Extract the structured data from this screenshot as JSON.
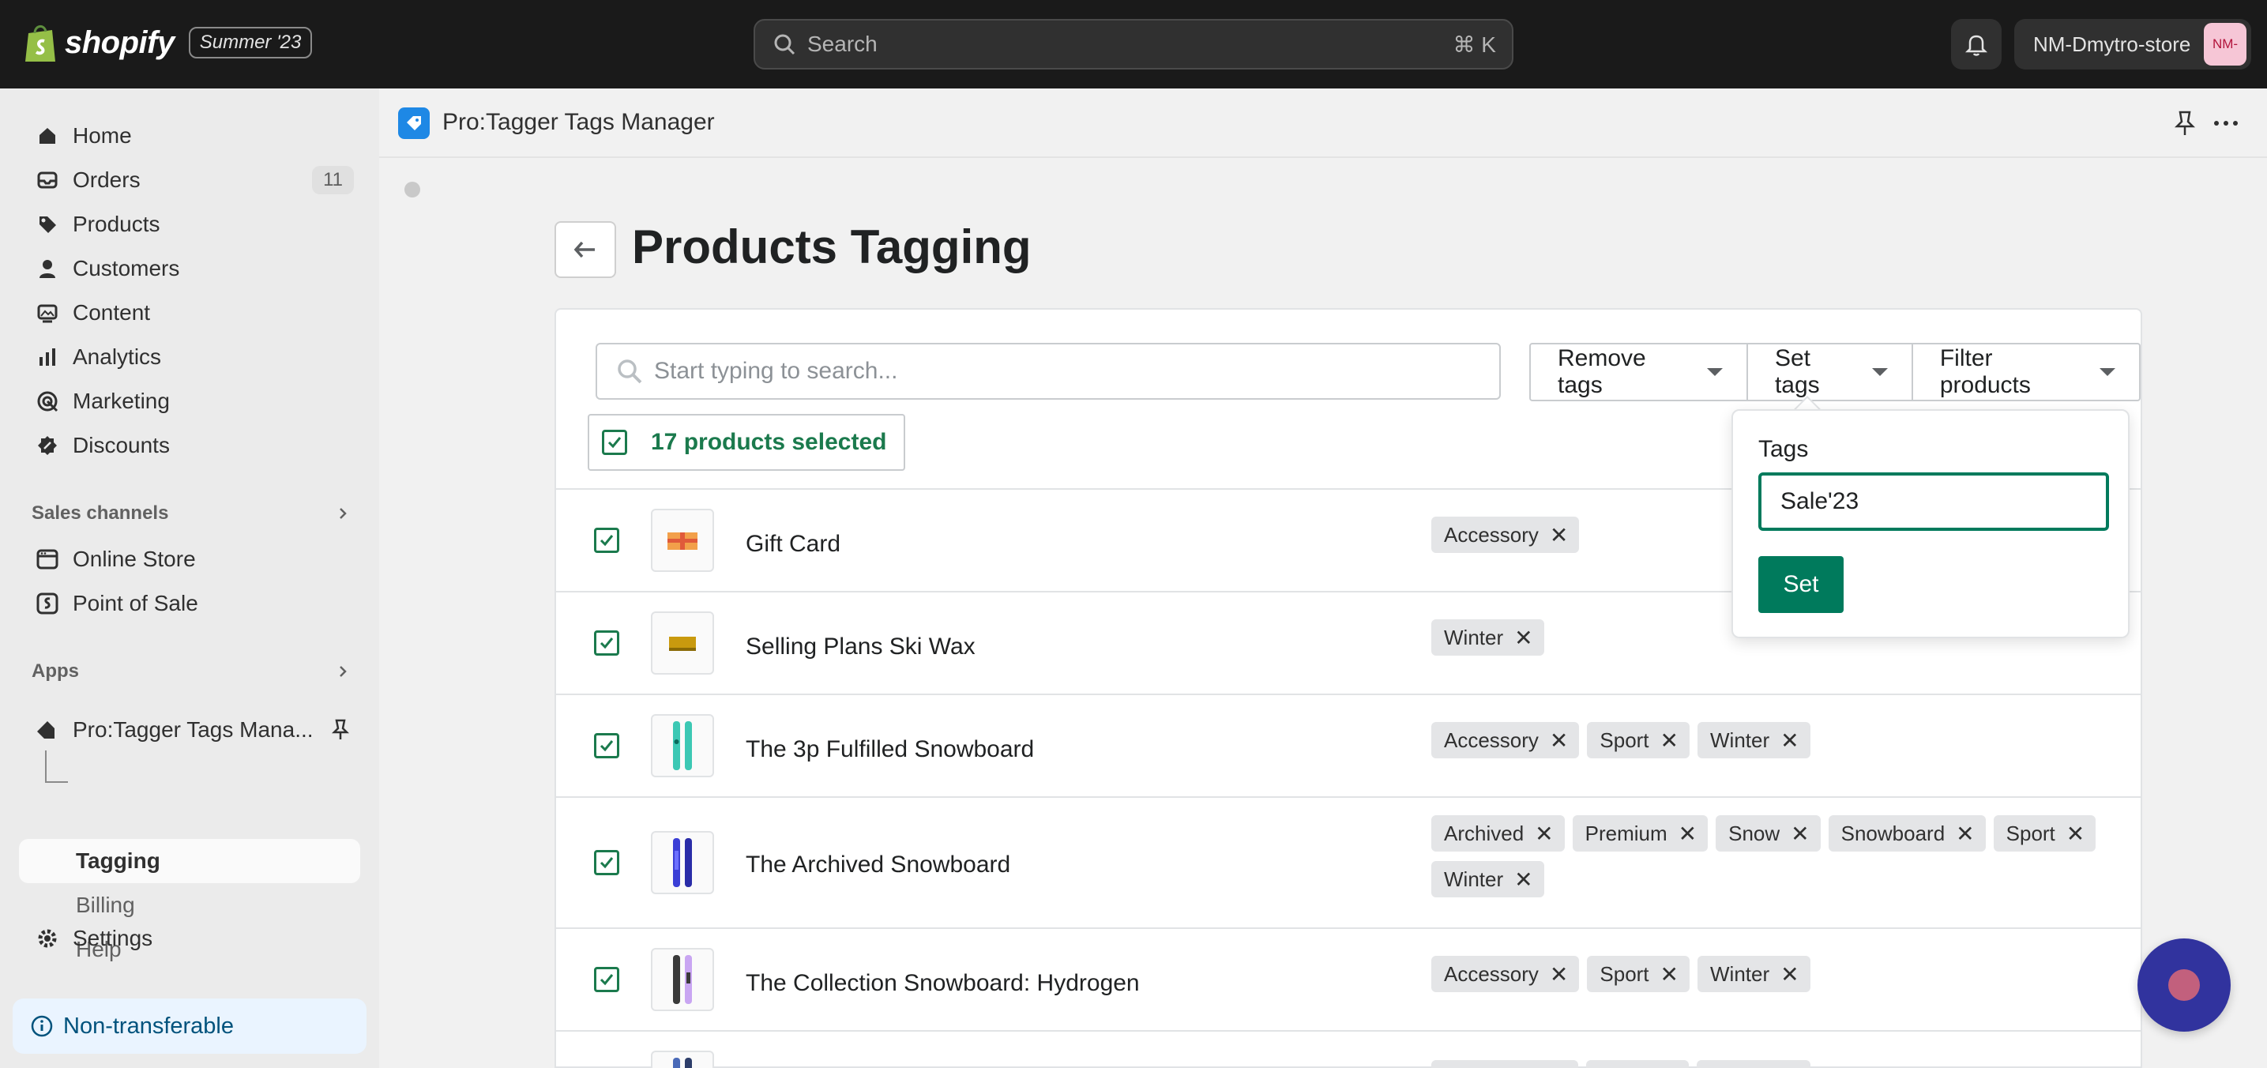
{
  "topbar": {
    "brand": "shopify",
    "edition": "Summer '23",
    "search_placeholder": "Search",
    "search_shortcut": "⌘ K",
    "store_name": "NM-Dmytro-store",
    "store_avatar": "NM-"
  },
  "sidebar": {
    "items": [
      {
        "label": "Home",
        "icon": "home-icon"
      },
      {
        "label": "Orders",
        "icon": "inbox-icon",
        "badge": "11"
      },
      {
        "label": "Products",
        "icon": "tag-icon"
      },
      {
        "label": "Customers",
        "icon": "person-icon"
      },
      {
        "label": "Content",
        "icon": "image-icon"
      },
      {
        "label": "Analytics",
        "icon": "bar-chart-icon"
      },
      {
        "label": "Marketing",
        "icon": "target-icon"
      },
      {
        "label": "Discounts",
        "icon": "discount-icon"
      }
    ],
    "sales_channels_title": "Sales channels",
    "sales_channels": [
      {
        "label": "Online Store",
        "icon": "store-icon"
      },
      {
        "label": "Point of Sale",
        "icon": "pos-icon"
      }
    ],
    "apps_title": "Apps",
    "app_name": "Pro:Tagger Tags Mana...",
    "app_subitems": [
      "Tagging",
      "Billing",
      "Help"
    ],
    "settings_label": "Settings",
    "nontransferable_label": "Non-transferable"
  },
  "app_header": {
    "title": "Pro:Tagger Tags Manager"
  },
  "page": {
    "title": "Products Tagging",
    "search_placeholder": "Start typing to search...",
    "remove_tags_label": "Remove tags",
    "set_tags_label": "Set tags",
    "filter_products_label": "Filter products",
    "selected_label": "17 products selected",
    "products": [
      {
        "name": "Gift Card",
        "tags": [
          "Accessory"
        ]
      },
      {
        "name": "Selling Plans Ski Wax",
        "tags": [
          "Winter"
        ]
      },
      {
        "name": "The 3p Fulfilled Snowboard",
        "tags": [
          "Accessory",
          "Sport",
          "Winter"
        ]
      },
      {
        "name": "The Archived Snowboard",
        "tags": [
          "Archived",
          "Premium",
          "Snow",
          "Snowboard",
          "Sport",
          "Winter"
        ]
      },
      {
        "name": "The Collection Snowboard: Hydrogen",
        "tags": [
          "Accessory",
          "Sport",
          "Winter"
        ]
      }
    ]
  },
  "popover": {
    "label": "Tags",
    "input_value": "Sale'23",
    "set_label": "Set"
  },
  "colors": {
    "accent_green": "#007a5c",
    "selected_green": "#1b7a4d",
    "topbar_bg": "#1a1a1a"
  }
}
